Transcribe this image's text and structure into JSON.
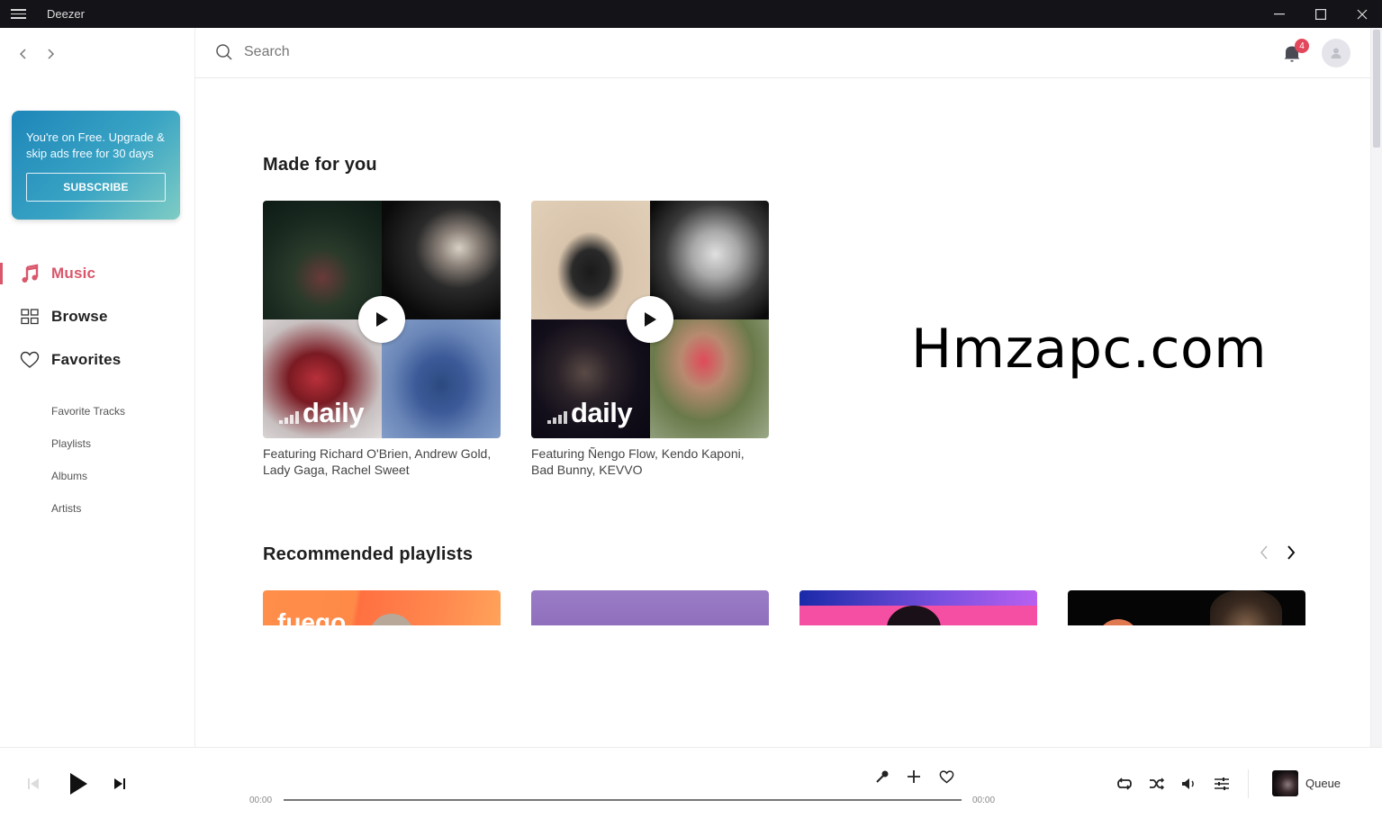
{
  "window": {
    "app_title": "Deezer",
    "controls": [
      "minimize",
      "maximize",
      "close"
    ]
  },
  "sidebar": {
    "promo": {
      "text": "You're on Free. Upgrade & skip ads free for 30 days",
      "button_label": "SUBSCRIBE"
    },
    "main_items": [
      {
        "label": "Music",
        "icon": "music-note-icon",
        "active": true
      },
      {
        "label": "Browse",
        "icon": "grid-icon",
        "active": false
      },
      {
        "label": "Favorites",
        "icon": "heart-icon",
        "active": false
      }
    ],
    "sub_items": [
      {
        "label": "Favorite Tracks"
      },
      {
        "label": "Playlists"
      },
      {
        "label": "Albums"
      },
      {
        "label": "Artists"
      }
    ]
  },
  "topbar": {
    "search_placeholder": "Search",
    "search_value": "",
    "notification_count": "4"
  },
  "content": {
    "made_for_you": {
      "title": "Made for you",
      "cards": [
        {
          "badge": "daily",
          "caption": "Featuring Richard O'Brien, Andrew Gold, Lady Gaga, Rachel Sweet"
        },
        {
          "badge": "daily",
          "caption": "Featuring Ñengo Flow, Kendo Kaponi, Bad Bunny, KEVVO"
        }
      ]
    },
    "watermark": "Hmzapc.com",
    "recommended": {
      "title": "Recommended playlists",
      "cards": [
        {
          "label_partial": "fuego"
        },
        {
          "label_partial": ""
        },
        {
          "label_partial": ""
        },
        {
          "label_partial": ""
        }
      ]
    }
  },
  "player": {
    "elapsed": "00:00",
    "duration": "00:00",
    "progress": 0,
    "queue_label": "Queue"
  },
  "colors": {
    "accent": "#d9566b",
    "titlebar": "#141318",
    "badge": "#e2475b"
  }
}
